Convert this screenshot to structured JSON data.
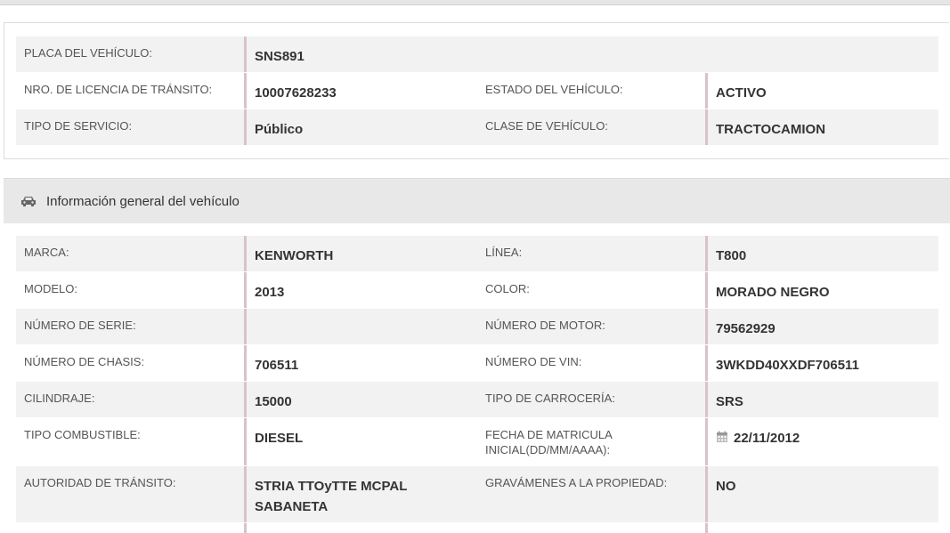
{
  "summary": {
    "rows": [
      {
        "l1": "PLACA DEL VEHÍCULO:",
        "v1": "SNS891"
      },
      {
        "l1": "NRO. DE LICENCIA DE TRÁNSITO:",
        "v1": "10007628233",
        "l2": "ESTADO DEL VEHÍCULO:",
        "v2": "ACTIVO"
      },
      {
        "l1": "TIPO DE SERVICIO:",
        "v1": "Público",
        "l2": "CLASE DE VEHÍCULO:",
        "v2": "TRACTOCAMION"
      }
    ]
  },
  "general": {
    "title": "Información general del vehículo",
    "icon": "car-icon",
    "rows": [
      {
        "l1": "MARCA:",
        "v1": "KENWORTH",
        "l2": "LÍNEA:",
        "v2": "T800"
      },
      {
        "l1": "MODELO:",
        "v1": "2013",
        "l2": "COLOR:",
        "v2": "MORADO NEGRO"
      },
      {
        "l1": "NÚMERO DE SERIE:",
        "v1": "",
        "l2": "NÚMERO DE MOTOR:",
        "v2": "79562929"
      },
      {
        "l1": "NÚMERO DE CHASIS:",
        "v1": "706511",
        "l2": "NÚMERO DE VIN:",
        "v2": "3WKDD40XXDF706511"
      },
      {
        "l1": "CILINDRAJE:",
        "v1": "15000",
        "l2": "TIPO DE CARROCERÍA:",
        "v2": "SRS"
      },
      {
        "l1": "TIPO COMBUSTIBLE:",
        "v1": "DIESEL",
        "l2": "FECHA DE MATRICULA INICIAL(DD/MM/AAAA):",
        "v2": "22/11/2012",
        "v2_icon": "calendar-icon"
      },
      {
        "l1": "AUTORIDAD DE TRÁNSITO:",
        "v1": "STRIA TTOyTTE MCPAL SABANETA",
        "l2": "GRAVÁMENES A LA PROPIEDAD:",
        "v2": "NO"
      }
    ]
  },
  "colors": {
    "value_border": "#d9c3c6",
    "row_shade": "#f2f2f2",
    "header_bg": "#e8e8e8"
  }
}
